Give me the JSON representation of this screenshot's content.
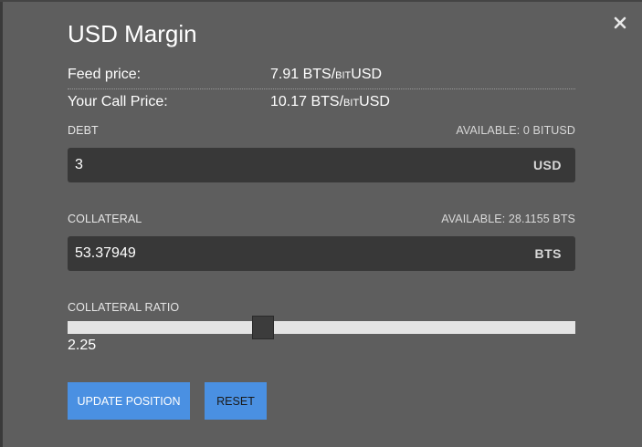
{
  "modal": {
    "title": "USD Margin",
    "close_label": "×"
  },
  "info": {
    "feed_price_label": "Feed price:",
    "feed_price_value": "7.91 BTS/",
    "feed_price_bit": "BIT",
    "feed_price_unit": "USD",
    "call_price_label": "Your Call Price:",
    "call_price_value": "10.17 BTS/",
    "call_price_bit": "BIT",
    "call_price_unit": "USD"
  },
  "debt": {
    "label": "DEBT",
    "available": "AVAILABLE: 0 BITUSD",
    "value": "3",
    "unit": "USD"
  },
  "collateral": {
    "label": "COLLATERAL",
    "available": "AVAILABLE: 28.1155 BTS",
    "value": "53.37949",
    "unit": "BTS"
  },
  "ratio": {
    "label": "COLLATERAL RATIO",
    "value": "2.25",
    "slider_fraction": 0.38
  },
  "buttons": {
    "update": "UPDATE POSITION",
    "reset": "RESET"
  },
  "colors": {
    "button_bg": "#4a90e2",
    "modal_bg": "#5e5e5e",
    "input_bg": "#383838",
    "track": "#e4e4e4"
  }
}
